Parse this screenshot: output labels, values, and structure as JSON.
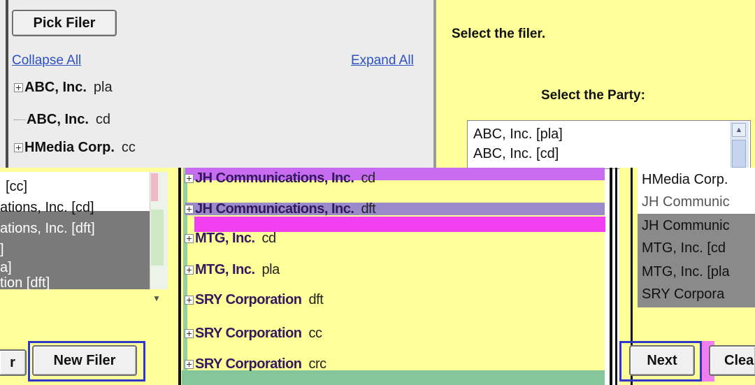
{
  "tree_panel": {
    "pick_filer_label": "Pick Filer",
    "collapse_all_label": "Collapse All",
    "expand_all_label": "Expand All",
    "rows": [
      {
        "name": "ABC, Inc.",
        "role": "pla",
        "expandable": true
      },
      {
        "name": "ABC, Inc.",
        "role": "cd",
        "expandable": false
      },
      {
        "name": "HMedia Corp.",
        "role": "cc",
        "expandable": true
      }
    ]
  },
  "right_panel": {
    "instruction": "Select the filer.",
    "party_label": "Select the Party:",
    "party_list": [
      "ABC, Inc. [pla]",
      "ABC, Inc. [cd]"
    ]
  },
  "bottom_left": {
    "list_items": [
      "[cc]",
      "ations, Inc. [cd]",
      "ations, Inc. [dft]",
      "]",
      "a]",
      "tion [dft]"
    ],
    "partial_button_label": "r",
    "new_filer_label": "New Filer"
  },
  "middle_tree": {
    "rows": [
      {
        "name": "JH Communications, Inc.",
        "role": "cd"
      },
      {
        "name": "JH Communications, Inc.",
        "role": "dft"
      },
      {
        "name": "MTG, Inc.",
        "role": "cd"
      },
      {
        "name": "MTG, Inc.",
        "role": "pla"
      },
      {
        "name": "SRY Corporation",
        "role": "dft"
      },
      {
        "name": "SRY Corporation",
        "role": "cc"
      },
      {
        "name": "SRY Corporation",
        "role": "crc"
      }
    ]
  },
  "bottom_right": {
    "list_items": [
      "HMedia Corp.",
      "JH Communic",
      "JH Communic",
      "MTG, Inc. [cd",
      "MTG, Inc. [pla",
      "SRY Corpora"
    ],
    "next_label": "Next",
    "clear_label": "Clea"
  },
  "colors": {
    "panel_yellow": "#ffff99",
    "tree_gray": "#ececec",
    "link_blue": "#2d51c4",
    "focus_blue": "#2f36c8",
    "glitch_magenta": "#f040f0"
  }
}
